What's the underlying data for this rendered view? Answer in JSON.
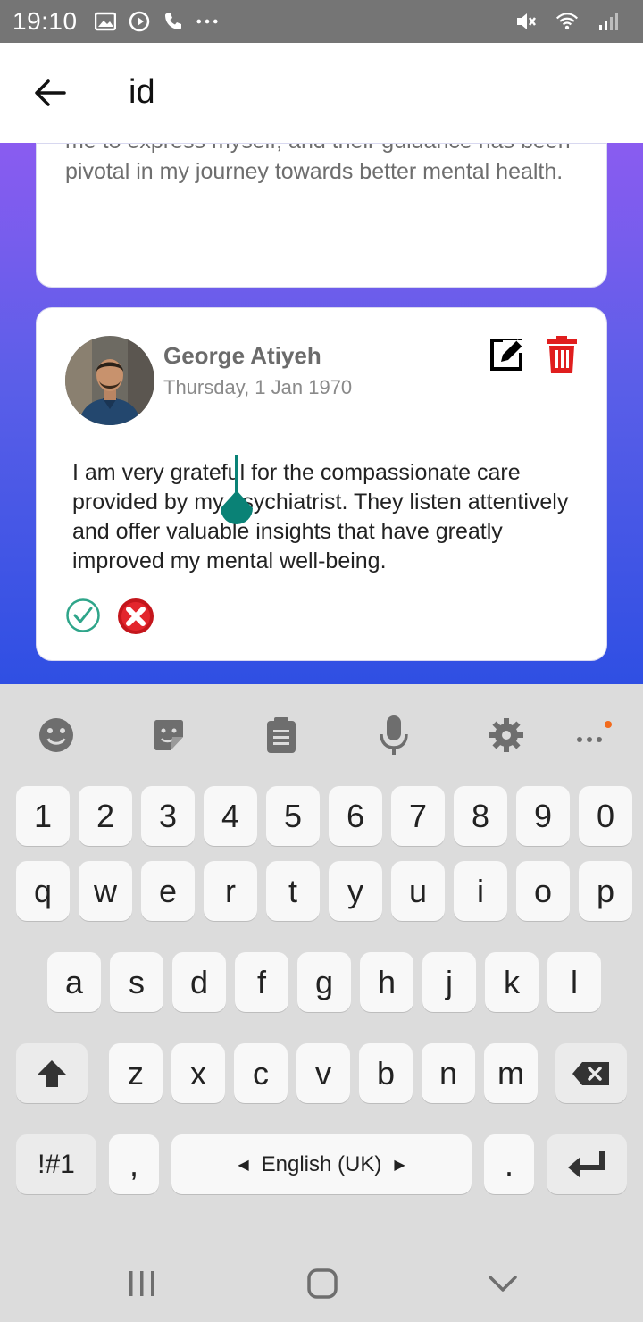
{
  "status_bar": {
    "time": "19:10",
    "icons": [
      "gallery-icon",
      "play-icon",
      "phone-icon",
      "more-dots-icon",
      "mute-icon",
      "wifi-icon",
      "signal-icon"
    ]
  },
  "app_bar": {
    "title": "id",
    "back_icon": "arrow-left-icon"
  },
  "previous_card": {
    "text": "me to express myself, and their guidance has been pivotal in my journey towards better mental health."
  },
  "review": {
    "author": "George Atiyeh",
    "date": "Thursday, 1 Jan 1970",
    "text": "I am very grateful for the compassionate care provided by my psychiatrist. They listen attentively and offer valuable insights that have greatly improved my mental well-being.",
    "actions": {
      "edit_icon": "edit-icon",
      "delete_icon": "trash-icon",
      "approve_icon": "check-circle-icon",
      "reject_icon": "close-circle-icon"
    }
  },
  "keyboard": {
    "toolbar": [
      "emoji-icon",
      "sticker-icon",
      "clipboard-icon",
      "mic-icon",
      "gear-icon",
      "more-icon"
    ],
    "row_numbers": [
      "1",
      "2",
      "3",
      "4",
      "5",
      "6",
      "7",
      "8",
      "9",
      "0"
    ],
    "row_1": [
      "q",
      "w",
      "e",
      "r",
      "t",
      "y",
      "u",
      "i",
      "o",
      "p"
    ],
    "row_2": [
      "a",
      "s",
      "d",
      "f",
      "g",
      "h",
      "j",
      "k",
      "l"
    ],
    "row_3": [
      "z",
      "x",
      "c",
      "v",
      "b",
      "n",
      "m"
    ],
    "symbols_label": "!#1",
    "comma_label": ",",
    "space_label": "English (UK)",
    "period_label": "."
  },
  "colors": {
    "accent": "#0a8276",
    "delete": "#e01e1e",
    "gradient_top": "#8a5cf0",
    "gradient_bottom": "#2f4fe3"
  }
}
